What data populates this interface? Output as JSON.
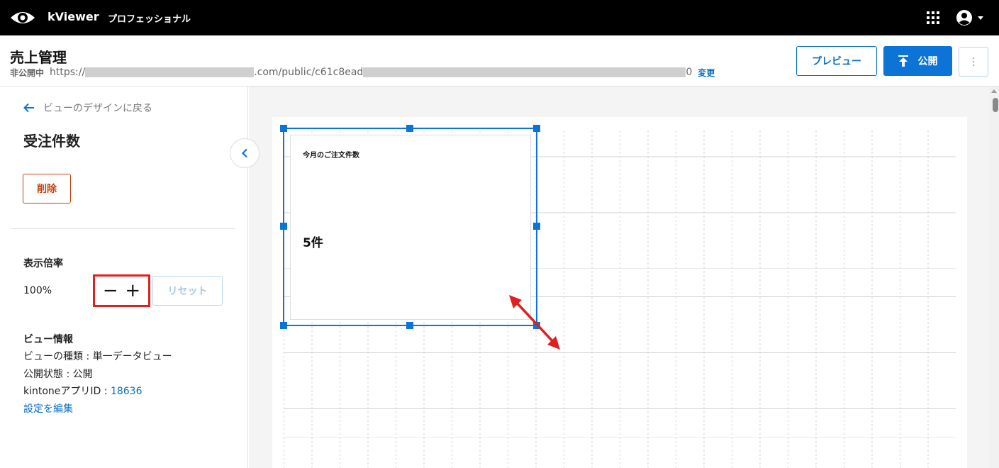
{
  "app": {
    "brand": "kViewer",
    "edition": "プロフェッショナル",
    "icons": {
      "logo": "eye-logo",
      "apps": "grid-apps-icon",
      "user": "account-icon"
    }
  },
  "header": {
    "title": "売上管理",
    "status": "非公開中",
    "url_prefix": "https://",
    "url_mid": ".com/public/c61c8ead",
    "url_suffix": "0",
    "change_label": "変更",
    "preview_label": "プレビュー",
    "publish_label": "公開"
  },
  "panel": {
    "back_label": "ビューのデザインに戻る",
    "title": "受注件数",
    "delete_label": "削除",
    "zoom": {
      "heading": "表示倍率",
      "value": "100%",
      "minus": "−",
      "plus": "+",
      "reset_label": "リセット"
    },
    "info": {
      "heading": "ビュー情報",
      "type_line": "ビューの種類 : 単一データビュー",
      "status_line": "公開状態 : 公開",
      "app_id_label": "kintoneアプリID : ",
      "app_id_value": "18636",
      "edit_settings": "設定を編集"
    }
  },
  "widget": {
    "title": "今月のご注文件数",
    "value": "5件"
  },
  "colors": {
    "accent": "#0b74d6",
    "danger": "#c1440e",
    "highlight": "#e02020",
    "topbar": "#000000"
  }
}
